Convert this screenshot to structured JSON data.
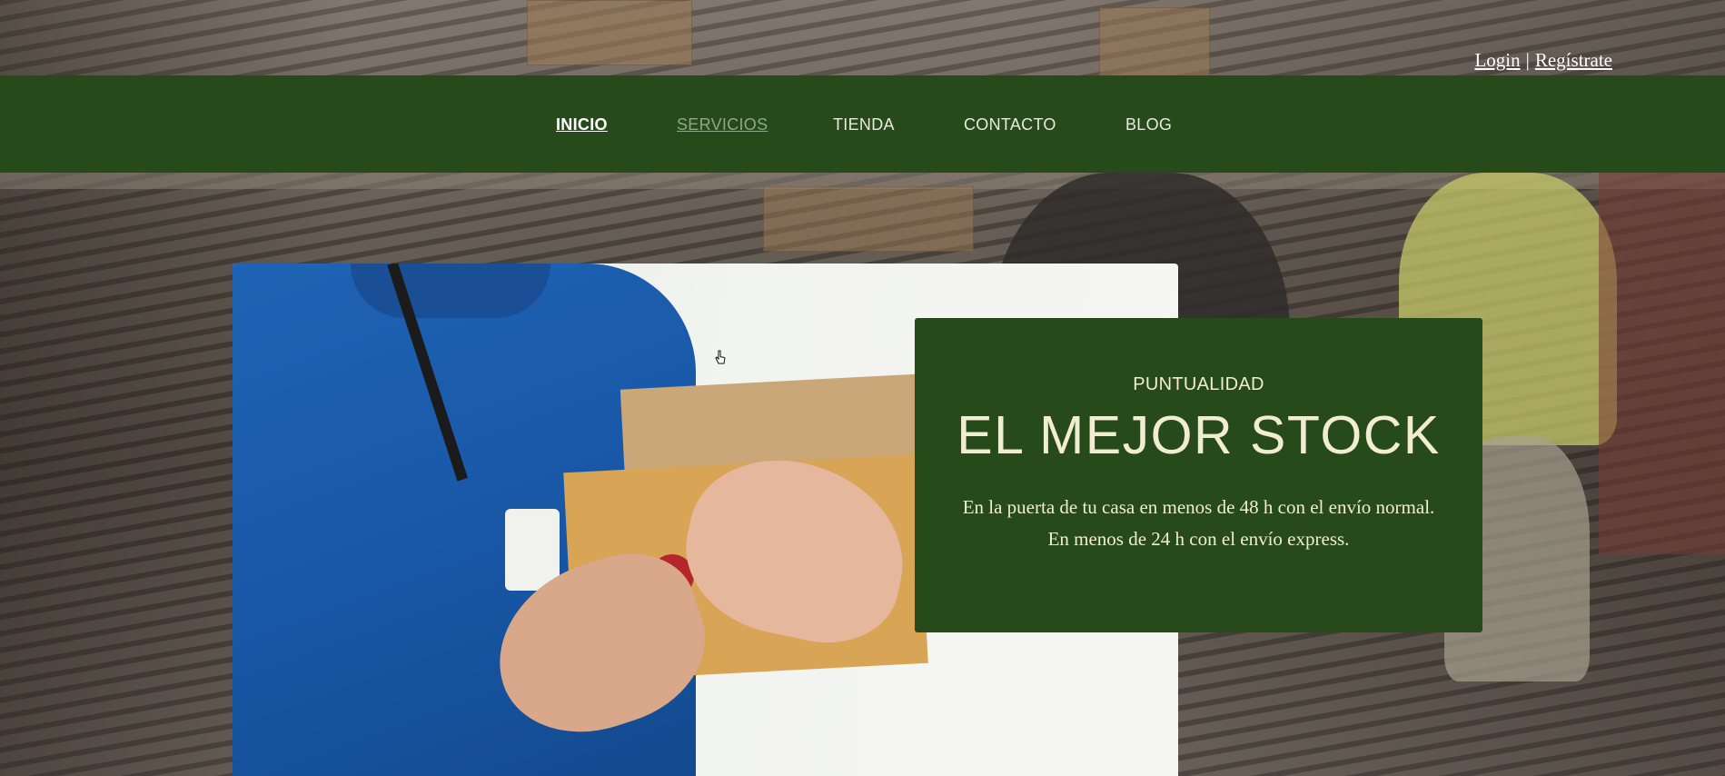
{
  "auth": {
    "login": "Login",
    "separator": "|",
    "register": "Regístrate"
  },
  "nav": {
    "items": [
      "INICIO",
      "SERVICIOS",
      "TIENDA",
      "CONTACTO",
      "BLOG"
    ],
    "active": "INICIO",
    "hovered": "SERVICIOS"
  },
  "promo": {
    "kicker": "PUNTUALIDAD",
    "title": "EL MEJOR STOCK",
    "text": "En la puerta de tu casa en menos de 48 h con el envío normal. En menos de 24 h con el envío express."
  },
  "colors": {
    "brand_green": "#264a1a",
    "promo_text": "#f1ecd2"
  },
  "icons": {
    "cursor": "hand-pointer-icon"
  }
}
